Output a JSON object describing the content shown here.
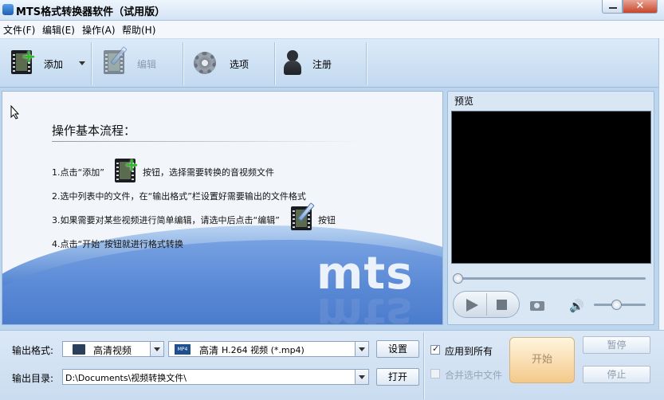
{
  "window": {
    "title": "MTS格式转换器软件（试用版）",
    "close_label": "✕"
  },
  "menu": [
    {
      "label": "文件(F)"
    },
    {
      "label": "编辑(E)"
    },
    {
      "label": "操作(A)"
    },
    {
      "label": "帮助(H)"
    }
  ],
  "toolbar": {
    "add": "添加",
    "edit": "编辑",
    "options": "选项",
    "register": "注册"
  },
  "info": {
    "title": "操作基本流程：",
    "step1a": "1.点击“添加”",
    "step1b": "按钮，选择需要转换的音视频文件",
    "step2": "2.选中列表中的文件，在“输出格式”栏设置好需要输出的文件格式",
    "step3a": "3.如果需要对某些视频进行简单编辑，请选中后点击“编辑”",
    "step3b": "按钮",
    "step4": "4.点击“开始”按钮就进行格式转换",
    "logo": "mts"
  },
  "preview": {
    "title": "预览"
  },
  "bottom": {
    "format_label": "输出格式:",
    "format_category": "高清视频",
    "format_value_a": "高清",
    "format_value_b": "H.264 视频 (*.mp4)",
    "mp4_icon_text": "MP4",
    "settings_button": "设置",
    "dir_label": "输出目录:",
    "dir_value": "D:\\Documents\\视频转换文件\\",
    "open_button": "打开",
    "apply_all": "应用到所有",
    "merge_selected": "合并选中文件",
    "start_button": "开始",
    "pause_button": "暂停",
    "stop_button": "停止"
  }
}
